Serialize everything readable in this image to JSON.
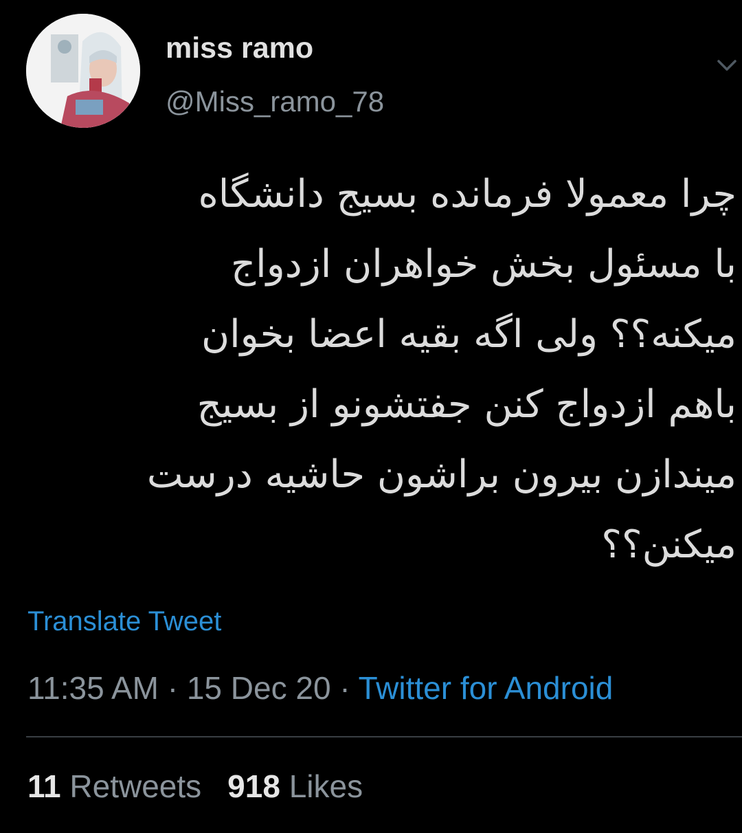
{
  "author": {
    "display_name": "miss ramo",
    "handle": "@Miss_ramo_78",
    "avatar_icon": "profile-photo"
  },
  "tweet": {
    "lines": [
      "چرا معمولا فرمانده بسیج دانشگاه",
      "با مسئول بخش خواهران ازدواج",
      "میکنه؟؟ ولی اگه بقیه اعضا بخوان",
      "باهم ازدواج کنن جفتشونو از بسیج",
      "میندازن بیرون براشون حاشیه درست",
      "میکنن؟؟"
    ],
    "translate_label": "Translate Tweet"
  },
  "meta": {
    "time": "11:35 AM",
    "separator": "·",
    "date": "15 Dec 20",
    "source": "Twitter for Android"
  },
  "stats": {
    "retweets_count": "11",
    "retweets_label": "Retweets",
    "likes_count": "918",
    "likes_label": "Likes"
  },
  "colors": {
    "background": "#000000",
    "link": "#2b8fd6",
    "muted": "#8b949c",
    "text": "#dcdcdc"
  }
}
